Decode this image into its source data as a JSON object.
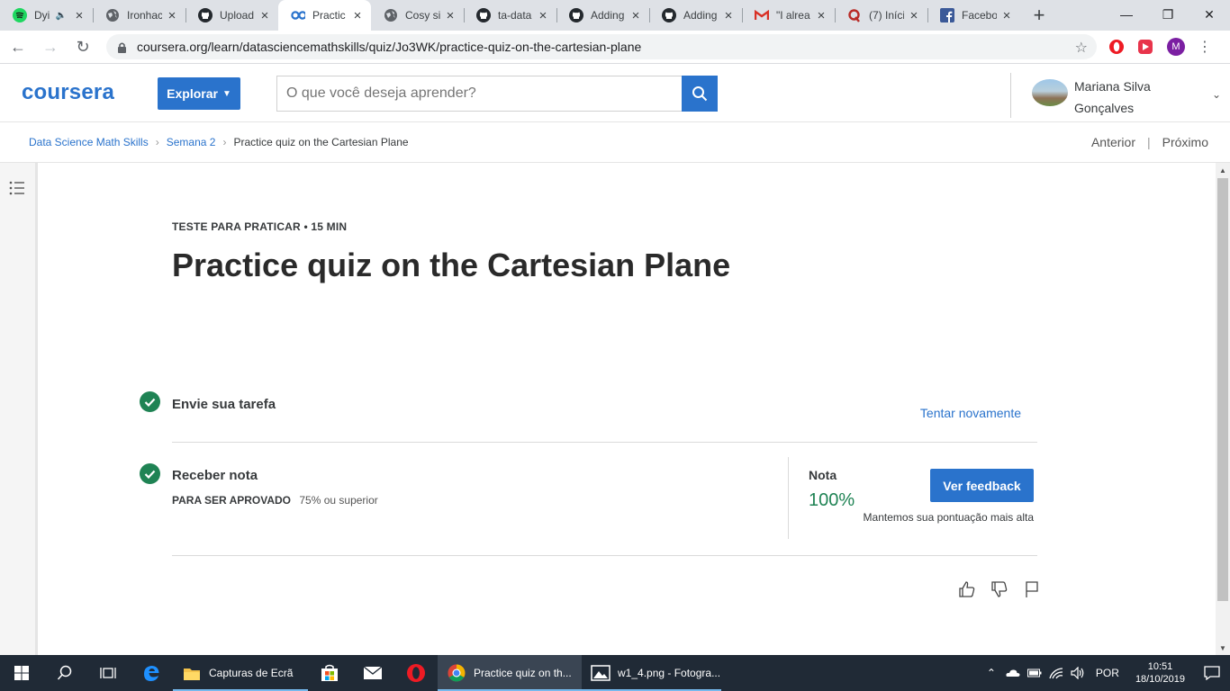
{
  "browser": {
    "tabs": [
      {
        "title": "Dyi",
        "favicon": "spotify-icon",
        "audio": true
      },
      {
        "title": "Ironhac",
        "favicon": "globe-icon"
      },
      {
        "title": "Upload",
        "favicon": "github-icon"
      },
      {
        "title": "Practic",
        "favicon": "coursera-icon",
        "active": true
      },
      {
        "title": "Cosy si",
        "favicon": "globe-icon"
      },
      {
        "title": "ta-data",
        "favicon": "github-icon"
      },
      {
        "title": "Adding",
        "favicon": "github-icon"
      },
      {
        "title": "Adding",
        "favicon": "github-icon"
      },
      {
        "title": "\"I alrea",
        "favicon": "gmail-icon"
      },
      {
        "title": "(7) Iníci",
        "favicon": "quora-icon"
      },
      {
        "title": "Facebo",
        "favicon": "facebook-icon"
      }
    ],
    "url": "coursera.org/learn/datasciencemathskills/quiz/Jo3WK/practice-quiz-on-the-cartesian-plane",
    "profile_initial": "M"
  },
  "header": {
    "logo": "coursera",
    "explore_label": "Explorar",
    "search_placeholder": "O que você deseja aprender?",
    "user_name": "Mariana Silva Gonçalves"
  },
  "breadcrumb": {
    "items": [
      "Data Science Math Skills",
      "Semana 2",
      "Practice quiz on the Cartesian Plane"
    ],
    "prev_label": "Anterior",
    "next_label": "Próximo"
  },
  "quiz": {
    "eyebrow": "TESTE PARA PRATICAR • 15 MIN",
    "title": "Practice quiz on the Cartesian Plane",
    "step1_label": "Envie sua tarefa",
    "retry_label": "Tentar novamente",
    "step2_label": "Receber nota",
    "pass_key": "PARA SER APROVADO",
    "pass_value": "75% ou superior",
    "grade_label": "Nota",
    "grade_value": "100%",
    "feedback_button": "Ver feedback",
    "grade_note": "Mantemos sua pontuação mais alta"
  },
  "taskbar": {
    "apps": [
      {
        "label": "Capturas de Ecrã",
        "icon": "folder-icon"
      },
      {
        "label": "Practice quiz on th...",
        "icon": "chrome-icon",
        "active": true
      },
      {
        "label": "w1_4.png - Fotogra...",
        "icon": "photos-icon"
      }
    ],
    "language": "POR",
    "time": "10:51",
    "date": "18/10/2019"
  },
  "colors": {
    "brand": "#2a73cc",
    "success": "#1f8354",
    "taskbar": "#202a36"
  }
}
